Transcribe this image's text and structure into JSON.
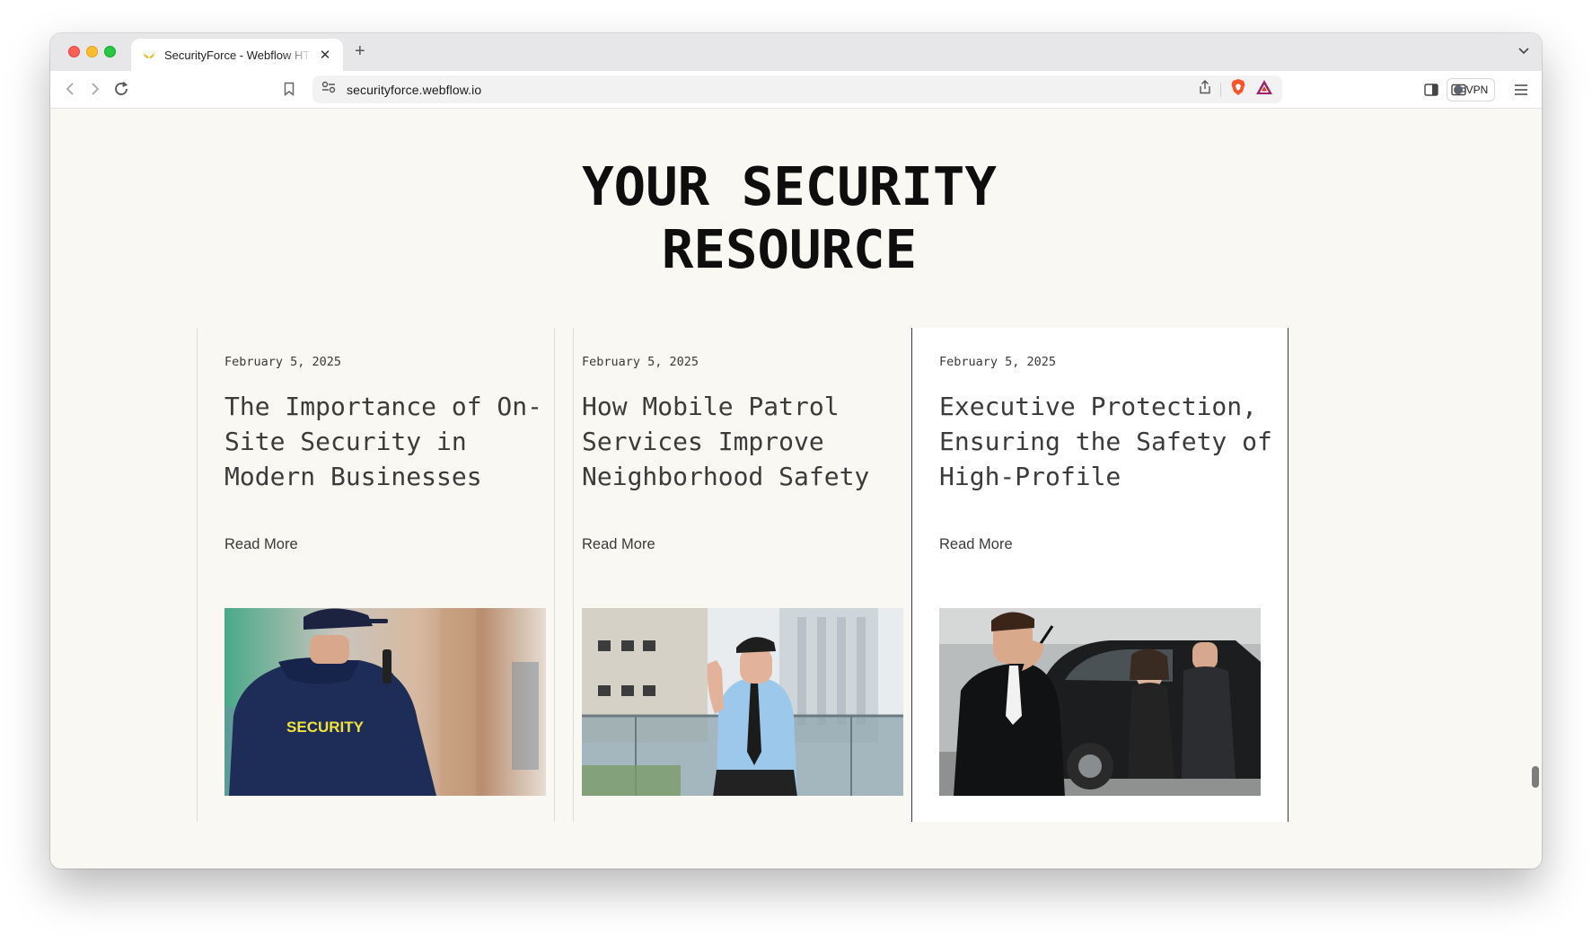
{
  "browser": {
    "tab_title": "SecurityForce - Webflow HTML website template",
    "tab_close": "✕",
    "new_tab": "+",
    "url": "securityforce.webflow.io",
    "vpn_label": "VPN"
  },
  "page": {
    "heading_line1": "YOUR SECURITY",
    "heading_line2": "RESOURCE",
    "cards": [
      {
        "date": "February 5, 2025",
        "title": "The Importance of On-Site Security in Modern Businesses",
        "link": "Read More",
        "image_text": "SECURITY",
        "image_icon": "security-guard-back-image"
      },
      {
        "date": "February 5, 2025",
        "title": "How Mobile Patrol Services Improve Neighborhood Safety",
        "link": "Read More",
        "image_icon": "patrol-officer-image"
      },
      {
        "date": "February 5, 2025",
        "title": "Executive Protection, Ensuring the Safety of High-Profile",
        "link": "Read More",
        "image_icon": "executive-protection-image"
      }
    ]
  },
  "colors": {
    "page_bg": "#faf8f2",
    "heading": "#0e0e0e",
    "active_card_border": "#3a3a3a",
    "security_text": "#f3e23a"
  }
}
